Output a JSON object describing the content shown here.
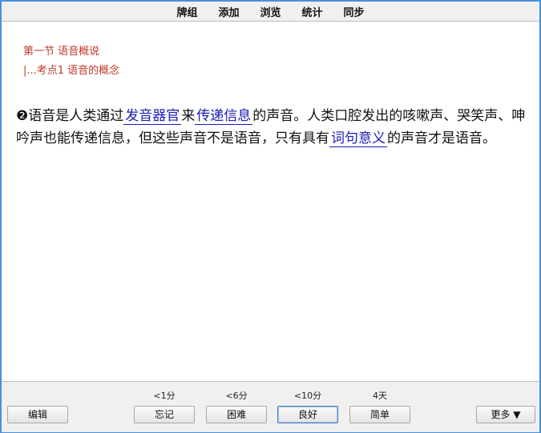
{
  "menu": {
    "items": [
      "牌组",
      "添加",
      "浏览",
      "统计",
      "同步"
    ]
  },
  "breadcrumb": {
    "section": "第一节 语音概说",
    "subsection": "|...考点1 语音的概念"
  },
  "card": {
    "marker": "❷",
    "text_1": "语音是人类通过",
    "cloze_1": "发音器官",
    "text_2": "来",
    "cloze_2": "传递信息",
    "text_3": "的声音。人类口腔发出的咳嗽声、哭笑声、呻吟声也能传递信息，但这些声音不是语音，只有具有",
    "cloze_3": "词句意义",
    "text_4": "的声音才是语音。"
  },
  "review": {
    "edit_label": "编辑",
    "more_label": "更多 ▼",
    "answers": [
      {
        "interval": "<1分",
        "label": "忘记"
      },
      {
        "interval": "<6分",
        "label": "困难"
      },
      {
        "interval": "<10分",
        "label": "良好"
      },
      {
        "interval": "4天",
        "label": "简单"
      }
    ]
  },
  "colors": {
    "accent_border": "#4a90d9",
    "breadcrumb_red": "#c0392b",
    "cloze_blue": "#1a1ab5"
  }
}
